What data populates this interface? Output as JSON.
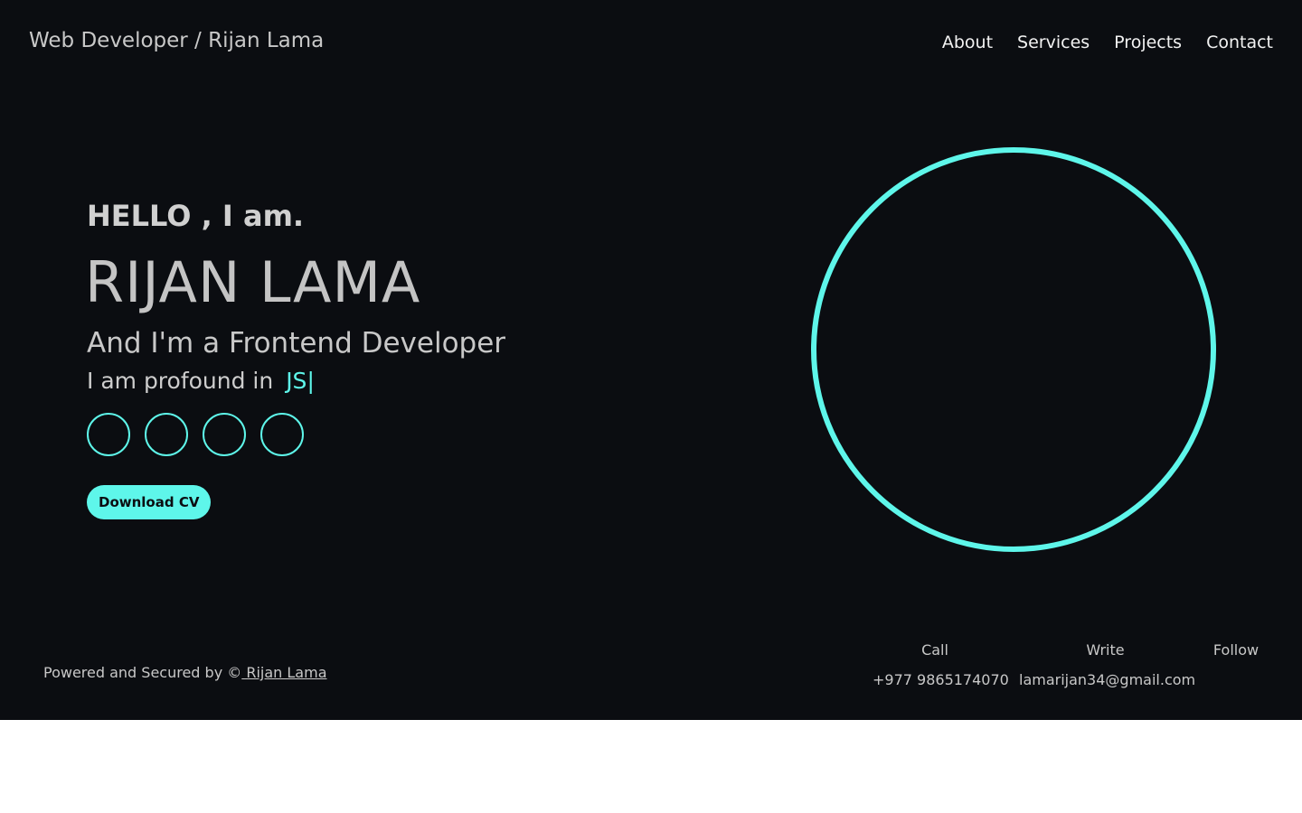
{
  "header": {
    "brand": "Web Developer / Rijan Lama",
    "nav": [
      "About",
      "Services",
      "Projects",
      "Contact"
    ]
  },
  "hero": {
    "greeting": "HELLO , I am.",
    "name": "RIJAN LAMA",
    "role": "And I'm a Frontend Developer",
    "profound_prefix": "I am profound in",
    "profound_skill": "JS",
    "cursor": "|",
    "socials": [
      "social-icon",
      "social-icon",
      "social-icon",
      "social-icon"
    ],
    "cv_button": "Download CV"
  },
  "footer": {
    "powered_text": "Powered and Secured by ©",
    "powered_link": " Rijan Lama",
    "call_label": "Call",
    "call_value": "+977 9865174070",
    "write_label": "Write",
    "write_value": "lamarijan34@gmail.com",
    "follow_label": "Follow"
  },
  "colors": {
    "background": "#0b0d11",
    "accent": "#5ef6ea",
    "below_page": "#ffffff"
  }
}
